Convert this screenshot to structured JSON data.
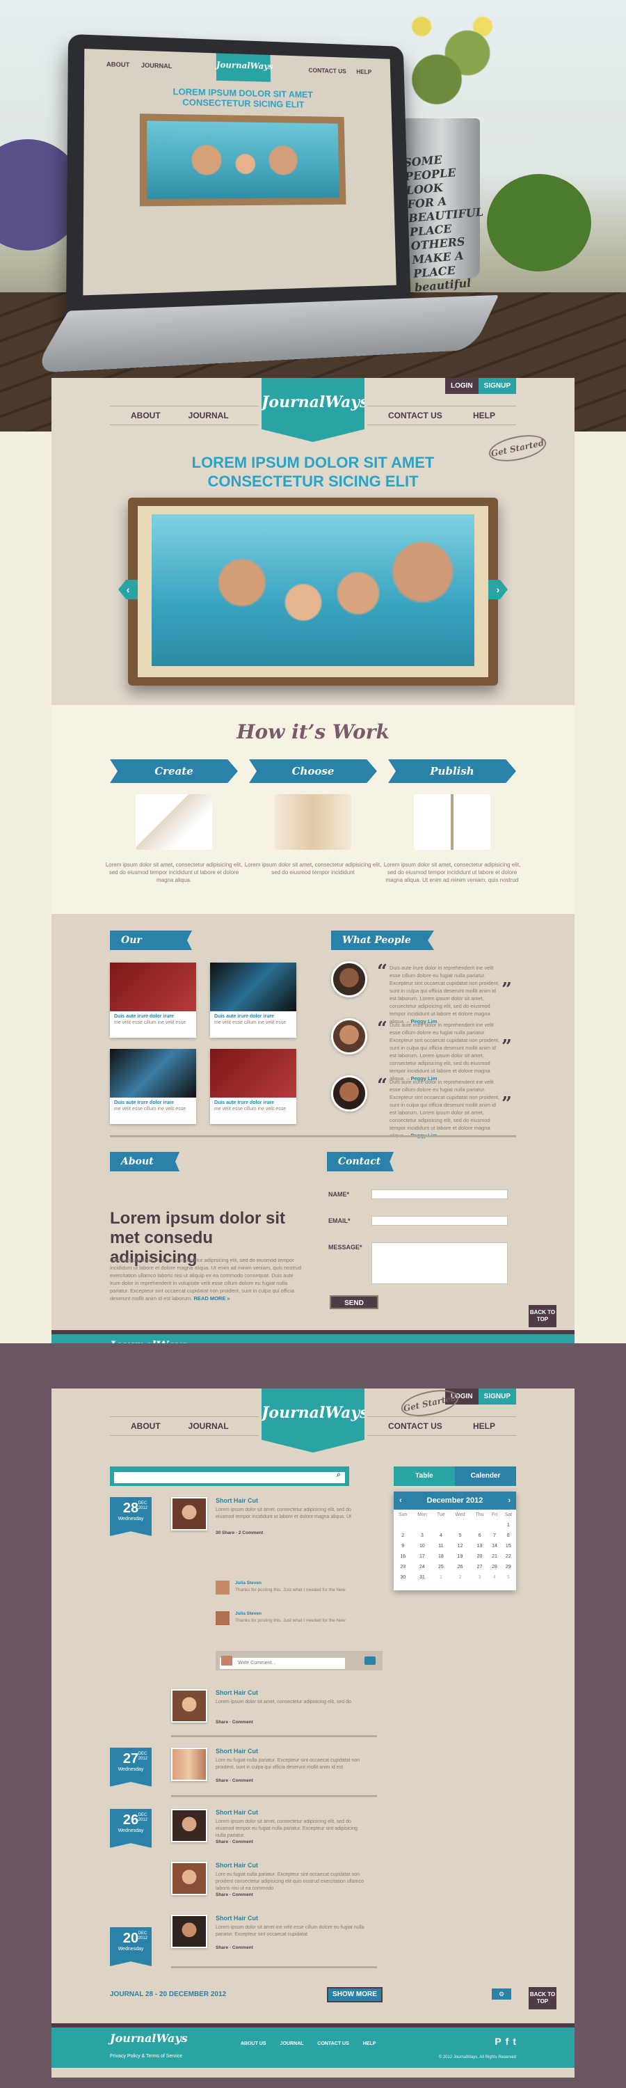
{
  "mockup": {
    "nav_about": "ABOUT",
    "nav_journal": "JOURNAL",
    "nav_contact": "CONTACT US",
    "nav_help": "HELP",
    "logo": "JournalWays",
    "title_line1": "LOREM IPSUM DOLOR SIT AMET",
    "title_line2": "CONSECTETUR SICING ELIT",
    "pot_text": "SOME PEOPLE LOOK FOR A BEAUTIFUL PLACE OTHERS MAKE A PLACE beautiful"
  },
  "page1": {
    "header": {
      "logo": "JournalWays",
      "login": "LOGIN",
      "signup": "SIGNUP",
      "nav_about": "ABOUT",
      "nav_journal": "JOURNAL",
      "nav_contact": "CONTACT US",
      "nav_help": "HELP",
      "get_started": "Get Started",
      "title_line1": "LOREM IPSUM DOLOR SIT AMET",
      "title_line2": "CONSECTETUR SICING ELIT",
      "prev": "‹",
      "next": "›"
    },
    "how": {
      "title": "How it’s Work",
      "steps": [
        {
          "label": "Create",
          "text": "Lorem ipsum dolor sit amet, consectetur adipisicing elit, sed do eiusmod tempor incididunt ut labore et dolore magna aliqua."
        },
        {
          "label": "Choose",
          "text": "Lorem ipsum dolor sit amet, consectetur adipisicing elit, sed do eiusmod tempor incididunt"
        },
        {
          "label": "Publish",
          "text": "Lorem ipsum dolor sit amet, consectetur adipisicing elit, sed do eiusmod tempor incididunt ut labore et dolore magna aliqua. Ut enim ad minim veniam, quis nostrud"
        }
      ]
    },
    "products": {
      "title": "Our Product",
      "items": [
        {
          "name": "Duis aute irure dolor irure",
          "desc": "me velit esse cillum ine velit esse"
        },
        {
          "name": "Duis aute irure dolor irure",
          "desc": "me velit esse cillum ine velit esse"
        },
        {
          "name": "Duis aute irure dolor irure",
          "desc": "me velit esse cillum ine velit esse"
        },
        {
          "name": "Duis aute irure dolor irure",
          "desc": "me velit esse cillum ine velit esse"
        }
      ]
    },
    "testimonials": {
      "title": "What People Say?",
      "items": [
        {
          "text": "Duis aute irure dolor in reprehenderit ine velit esse cillum dolore eu fugiat nulla pariatur. Excepteur sint occaecat cupidatat non proident, sunt in culpa qui officia deserunt mollit anim id est laborum. Lorem ipsum dolor sit amet, consectetur adipisicing elit, sed do eiusmod tempor incididunt ut labore et dolore magna aliqua.",
          "author": "Peggy Lim"
        },
        {
          "text": "Duis aute irure dolor in reprehenderit ine velit esse cillum dolore eu fugiat nulla pariatur. Excepteur sint occaecat cupidatat non proident, sunt in culpa qui officia deserunt mollit anim id est laborum. Lorem ipsum dolor sit amet, consectetur adipisicing elit, sed do eiusmod tempor incididunt ut labore et dolore magna aliqua.",
          "author": "Peggy Lim"
        },
        {
          "text": "Duis aute irure dolor in reprehenderit ine velit esse cillum dolore eu fugiat nulla pariatur. Excepteur sint occaecat cupidatat non proident, sunt in culpa qui officia deserunt mollit anim id est laborum. Lorem ipsum dolor sit amet, consectetur adipisicing elit, sed do eiusmod tempor incididunt ut labore et dolore magna aliqua.",
          "author": "Peggy Lim"
        }
      ]
    },
    "about": {
      "title": "About Us",
      "heading": "Lorem ipsum dolor sit met consedu adipisicing",
      "text": "Lorem ipsum dolor sit amet, consectetur adipisicing elit, sed do eiusmod tempor incididunt ut labore et dolore magna aliqua. Ut enim ad minim veniam, quis nostrud exercitation ullamco laboris nisi ut aliquip ex ea commodo consequat. Duis aute irure dolor in reprehenderit in voluptate velit esse cillum dolore eu fugiat nulla pariatur. Excepteur sint occaecat cupidatat non proident, sunt in culpa qui officia deserunt mollit anim id est laborum.",
      "read_more": "READ MORE »"
    },
    "contact": {
      "title": "Contact",
      "name_label": "NAME*",
      "email_label": "EMAIL*",
      "message_label": "MESSAGE*",
      "send": "SEND"
    },
    "back_to_top": "BACK TO TOP"
  },
  "footer": {
    "logo": "JournalWays",
    "links": "Privacy Policy & Terms of Service",
    "nav": [
      "ABOUT US",
      "JOURNAL",
      "CONTACT US",
      "HELP"
    ],
    "social": [
      "P",
      "f",
      "t"
    ],
    "copyright": "© 2012 JournalWays, All Rights Reserved"
  },
  "page2": {
    "header": {
      "logo": "JournalWays",
      "login": "LOGIN",
      "signup": "SIGNUP",
      "nav_about": "ABOUT",
      "nav_journal": "JOURNAL",
      "nav_contact": "CONTACT US",
      "nav_help": "HELP",
      "get_started": "Get Started"
    },
    "search": {
      "placeholder": "",
      "icon": "⌕"
    },
    "tabs": {
      "table": "Table",
      "calendar": "Calender"
    },
    "calendar": {
      "month": "December 2012",
      "prev": "‹",
      "next": "›",
      "weekdays": [
        "Sun",
        "Mon",
        "Tue",
        "Wed",
        "Thu",
        "Fri",
        "Sat"
      ],
      "weeks": [
        [
          "",
          "",
          "",
          "",
          "",
          "",
          "1"
        ],
        [
          "2",
          "3",
          "4",
          "5",
          "6",
          "7",
          "8"
        ],
        [
          "9",
          "10",
          "11",
          "12",
          "13",
          "14",
          "15"
        ],
        [
          "16",
          "17",
          "18",
          "19",
          "20",
          "21",
          "22"
        ],
        [
          "23",
          "24",
          "25",
          "26",
          "27",
          "28",
          "29"
        ],
        [
          "30",
          "31",
          "1",
          "2",
          "3",
          "4",
          "5"
        ]
      ]
    },
    "entries": [
      {
        "day": "28",
        "mon": "DEC",
        "year": "2012",
        "weekday": "Wednesday",
        "title": "Short Hair Cut",
        "text": "Lorem ipsum dolor sit amet, consectetur adipisicing elit, sed do eiusmod tempor incididunt ut labore et dolore magna aliqua. Ut",
        "stats": "30 Share · 2 Comment",
        "replies": [
          {
            "name": "Julia Steven",
            "text": "Thanks for posting this. Just what I needed for the New"
          },
          {
            "name": "Julia Steven",
            "text": "Thanks for posting this. Just what I needed for the New"
          }
        ],
        "write_placeholder": "Write Comment..."
      },
      {
        "title": "Short Hair Cut",
        "text": "Lorem ipsum dolor sit amet, consectetur adipisicing elit, sed do",
        "stats": "Share · Comment"
      },
      {
        "day": "27",
        "mon": "DEC",
        "year": "2012",
        "weekday": "Wednesday",
        "title": "Short Hair Cut",
        "text": "Lore eu fugiat nulla pariatur. Excepteur sint occaecat cupidatat non proident, sunt in culpa qui officia deserunt mollit anim id est",
        "stats": "Share · Comment"
      },
      {
        "day": "26",
        "mon": "DEC",
        "year": "2012",
        "weekday": "Wednesday",
        "title": "Short Hair Cut",
        "text": "Lorem ipsum dolor sit amet, consectetur adipisicing elit, sed do eiusmod tempor eu fugiat nulla pariatur. Excepteur sint adipisicing nulla pariatur.",
        "stats": "Share · Comment"
      },
      {
        "title": "Short Hair Cut",
        "text": "Lore eu fugiat nulla pariatur. Excepteur sint occaecat cupidatat non proident consectetur adipisicing elit quis nostrud exercitation ullamco laboris nisi ut ea commodo",
        "stats": "Share · Comment"
      },
      {
        "title": "Short Hair Cut",
        "text": "Lorem ipsum dolor sit amet ine velit esse cillum dolore eu fugiat nulla pariatur. Excepteur sint occaecat cupidatat",
        "stats": "Share · Comment"
      },
      {
        "day": "20",
        "mon": "DEC",
        "year": "2012",
        "weekday": "Wednesday",
        "title": "Short Hair Cut",
        "text": "Lore eu fugiat nulla pariatur. Excepteur sint occaecat cupidatat non proident, sunt in culpa qui officia",
        "stats": "Share · Comment"
      }
    ],
    "range": "JOURNAL 28 - 20 DECEMBER 2012",
    "show_more": "SHOW MORE",
    "back_to_top": "BACK TO TOP"
  },
  "colors": {
    "teal": "#2aa3a5",
    "blue": "#2a82a8",
    "plum": "#4f3c47",
    "beige": "#ddd4c6"
  }
}
